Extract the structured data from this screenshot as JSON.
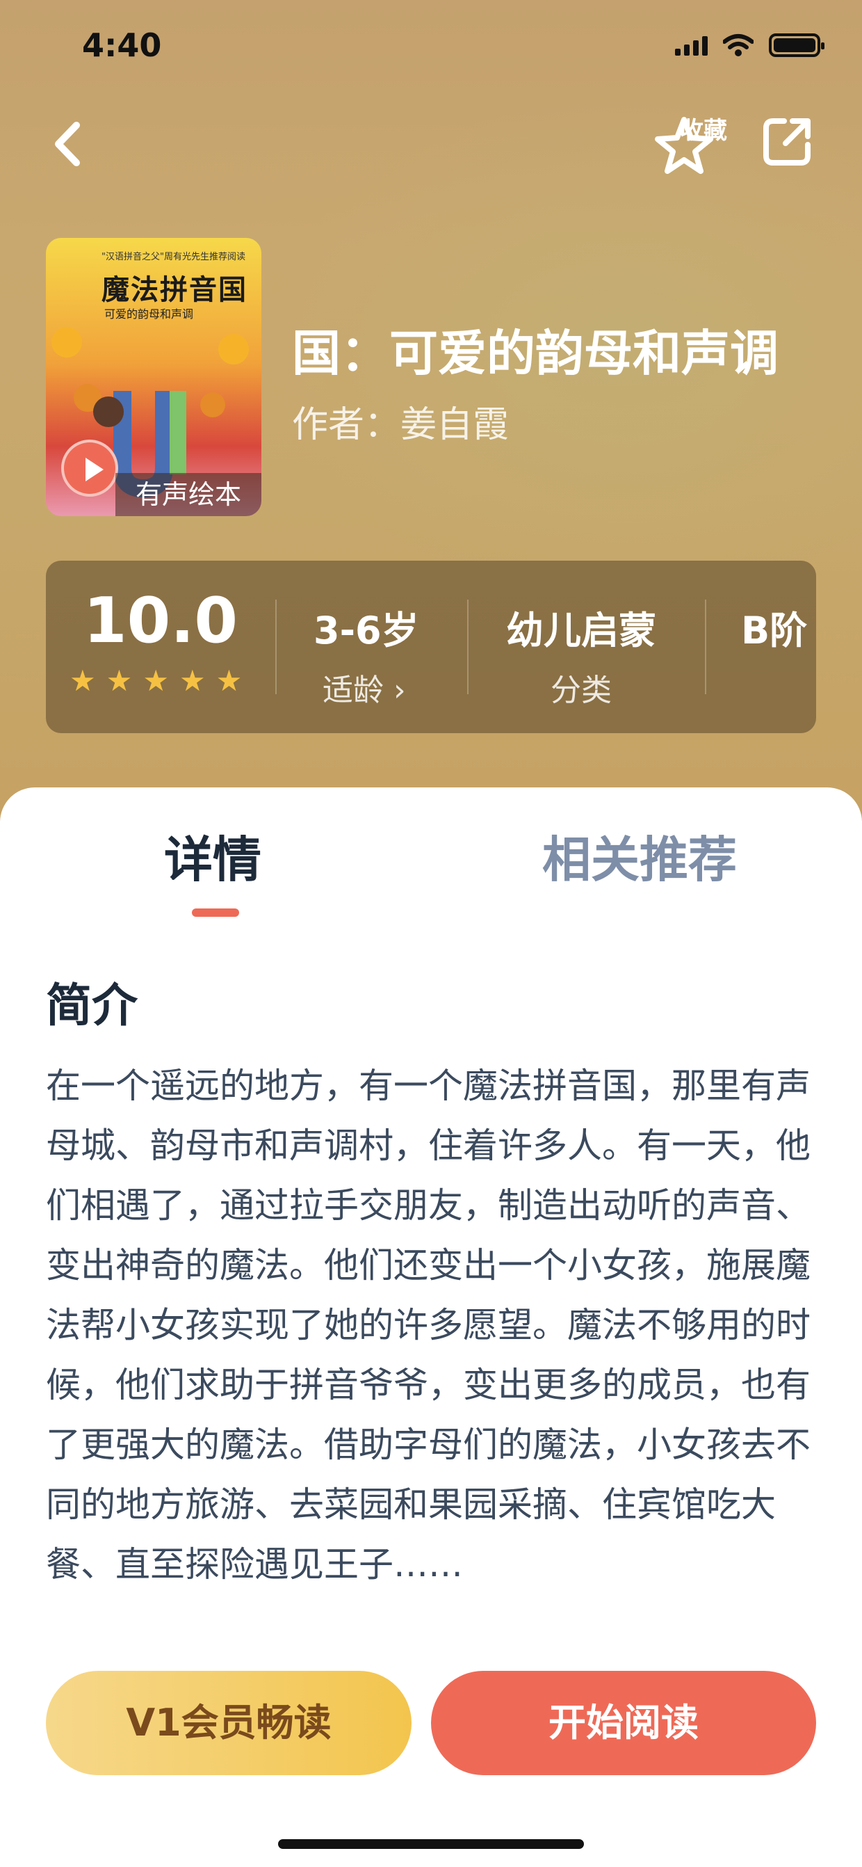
{
  "status_bar": {
    "time": "4:40"
  },
  "nav": {
    "favorite_label": "收藏"
  },
  "cover": {
    "top_text": "\"汉语拼音之父\"周有光先生推荐阅读",
    "series_title": "魔法拼音国",
    "subtitle": "可爱的韵母和声调",
    "badge": "有声绘本"
  },
  "book": {
    "title": "国：可爱的韵母和声调",
    "author": "作者：姜自霞"
  },
  "stats": {
    "score": "10.0",
    "rating_stars": 5,
    "age_value": "3-6岁",
    "age_label": "适龄 ›",
    "category_value": "幼儿启蒙",
    "category_label": "分类",
    "level_value": "B阶"
  },
  "tabs": {
    "detail": "详情",
    "recommend": "相关推荐"
  },
  "intro": {
    "title": "简介",
    "text": "在一个遥远的地方，有一个魔法拼音国，那里有声母城、韵母市和声调村，住着许多人。有一天，他们相遇了，通过拉手交朋友，制造出动听的声音、变出神奇的魔法。他们还变出一个小女孩，施展魔法帮小女孩实现了她的许多愿望。魔法不够用的时候，他们求助于拼音爷爷，变出更多的成员，也有了更强大的魔法。借助字母们的魔法，小女孩去不同的地方旅游、去菜园和果园采摘、住宾馆吃大餐、直至探险遇见王子……"
  },
  "buttons": {
    "vip": "V1会员畅读",
    "read": "开始阅读"
  },
  "colors": {
    "accent": "#ee6a57",
    "gold": "#f6c143",
    "text_dark": "#1d2a3a"
  }
}
